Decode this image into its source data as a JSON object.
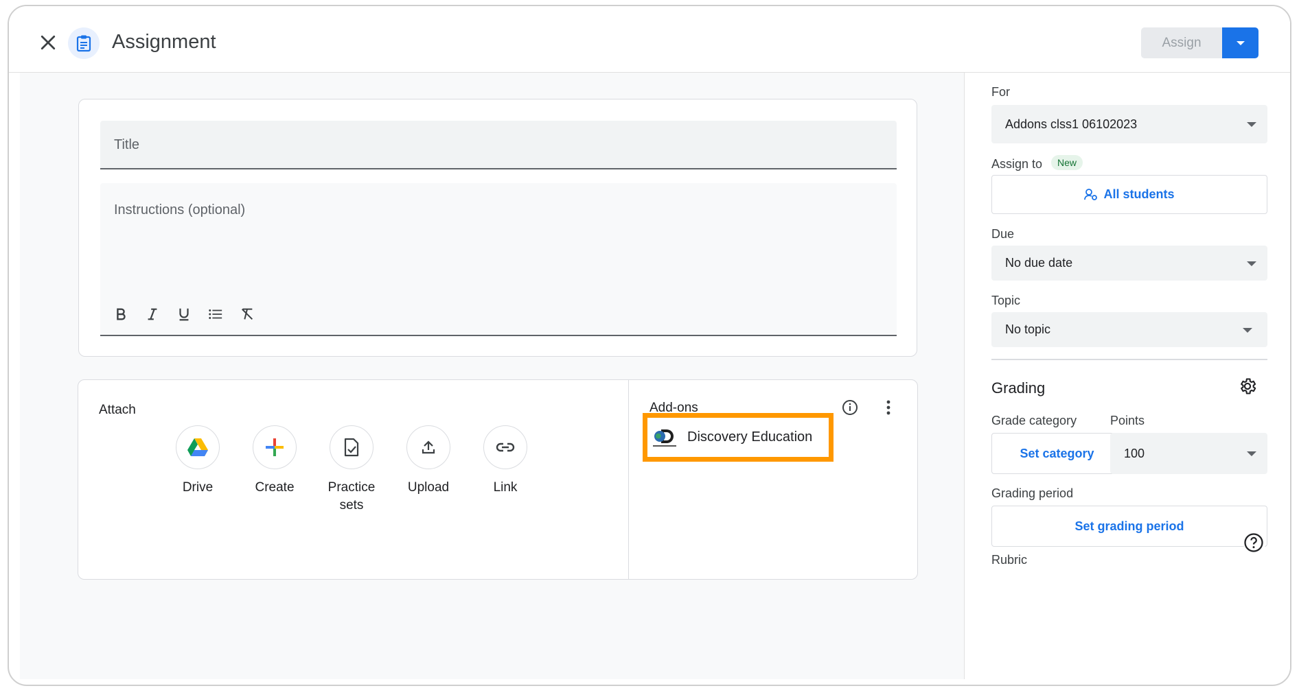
{
  "header": {
    "title": "Assignment",
    "assign_label": "Assign"
  },
  "content": {
    "title_placeholder": "Title",
    "instructions_placeholder": "Instructions (optional)",
    "toolbar": [
      "bold-icon",
      "italic-icon",
      "underline-icon",
      "bulleted-list-icon",
      "clear-formatting-icon"
    ]
  },
  "attach": {
    "label": "Attach",
    "items": [
      {
        "label": "Drive",
        "icon": "google-drive-icon"
      },
      {
        "label": "Create",
        "icon": "plus-icon"
      },
      {
        "label": "Practice sets",
        "icon": "practice-sets-icon"
      },
      {
        "label": "Upload",
        "icon": "upload-icon"
      },
      {
        "label": "Link",
        "icon": "link-icon"
      }
    ]
  },
  "addons": {
    "label": "Add-ons",
    "items": [
      {
        "name": "Discovery Education",
        "icon": "discovery-education-logo",
        "highlight_color": "#ff9800"
      }
    ]
  },
  "side": {
    "for_label": "For",
    "for_value": "Addons clss1 06102023",
    "assign_to_label": "Assign to",
    "assign_to_badge": "New",
    "assign_to_value": "All students",
    "due_label": "Due",
    "due_value": "No due date",
    "topic_label": "Topic",
    "topic_value": "No topic",
    "grading_heading": "Grading",
    "grade_category_label": "Grade category",
    "grade_category_value": "Set category",
    "points_label": "Points",
    "points_value": "100",
    "grading_period_label": "Grading period",
    "grading_period_value": "Set grading period",
    "rubric_label": "Rubric"
  },
  "colors": {
    "accent": "#1a73e8",
    "highlight": "#ff9800",
    "badge_bg": "#e6f4ea",
    "badge_text": "#137333"
  }
}
